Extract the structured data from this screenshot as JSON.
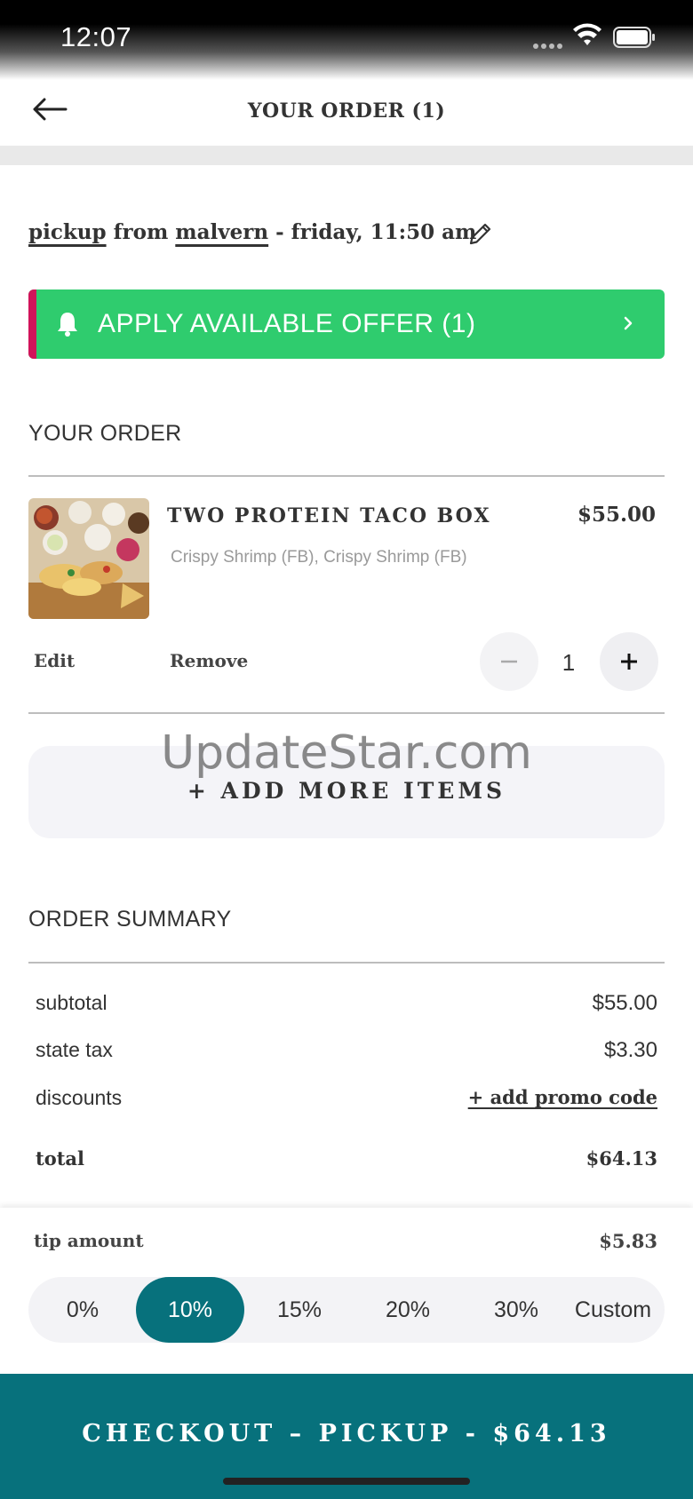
{
  "status_bar": {
    "time": "12:07"
  },
  "header": {
    "title": "YOUR ORDER (1)"
  },
  "pickup": {
    "prefix": "pickup",
    "from_word": " from ",
    "location": "malvern",
    "when": " - friday, 11:50 am"
  },
  "offer": {
    "label": "APPLY AVAILABLE OFFER (1)",
    "color": "#2fcc6e",
    "stripe_color": "#d1145a"
  },
  "your_order": {
    "heading": "YOUR ORDER",
    "items": [
      {
        "name": "TWO PROTEIN TACO BOX",
        "price": "$55.00",
        "modifiers": "Crispy Shrimp (FB), Crispy Shrimp (FB)",
        "edit_label": "Edit",
        "remove_label": "Remove",
        "quantity": "1"
      }
    ],
    "add_more_label": "+ ADD MORE ITEMS"
  },
  "watermark": "UpdateStar.com",
  "summary": {
    "heading": "ORDER SUMMARY",
    "subtotal_label": "subtotal",
    "subtotal_value": "$55.00",
    "tax_label": "state tax",
    "tax_value": "$3.30",
    "discounts_label": "discounts",
    "promo_label": "+ add promo code",
    "total_label": "total",
    "total_value": "$64.13"
  },
  "tip": {
    "label": "tip amount",
    "value": "$5.83",
    "options": [
      "0%",
      "10%",
      "15%",
      "20%",
      "30%",
      "Custom"
    ],
    "selected": "10%"
  },
  "checkout": {
    "label": "CHECKOUT – PICKUP - $64.13",
    "color": "#07717c"
  }
}
